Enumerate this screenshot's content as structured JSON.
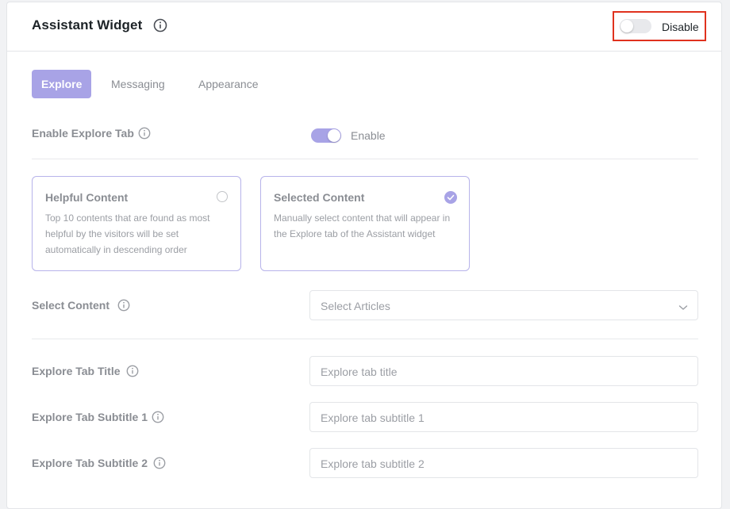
{
  "header": {
    "title": "Assistant Widget",
    "toggle": {
      "state": "off",
      "label": "Disable"
    }
  },
  "tabs": [
    {
      "label": "Explore",
      "active": true
    },
    {
      "label": "Messaging",
      "active": false
    },
    {
      "label": "Appearance",
      "active": false
    }
  ],
  "explore": {
    "enable_tab": {
      "label": "Enable Explore Tab",
      "toggle_state": "on",
      "toggle_label": "Enable"
    },
    "content_options": [
      {
        "title": "Helpful Content",
        "description": "Top 10 contents that are found as most helpful by the visitors will be set automatically in descending order",
        "selected": false
      },
      {
        "title": "Selected Content",
        "description": "Manually select content that will appear in the Explore tab of the Assistant widget",
        "selected": true
      }
    ],
    "select_content": {
      "label": "Select Content",
      "placeholder": "Select Articles"
    },
    "tab_title": {
      "label": "Explore Tab Title",
      "placeholder": "Explore tab title"
    },
    "subtitle_1": {
      "label": "Explore Tab Subtitle 1",
      "placeholder": "Explore tab subtitle 1"
    },
    "subtitle_2": {
      "label": "Explore Tab Subtitle 2",
      "placeholder": "Explore tab subtitle 2"
    }
  },
  "colors": {
    "accent": "#a8a3e6",
    "highlight": "#e0321e"
  },
  "icons": {
    "info": "info-circle-icon",
    "chevron": "chevron-down-icon",
    "check": "check-icon"
  }
}
